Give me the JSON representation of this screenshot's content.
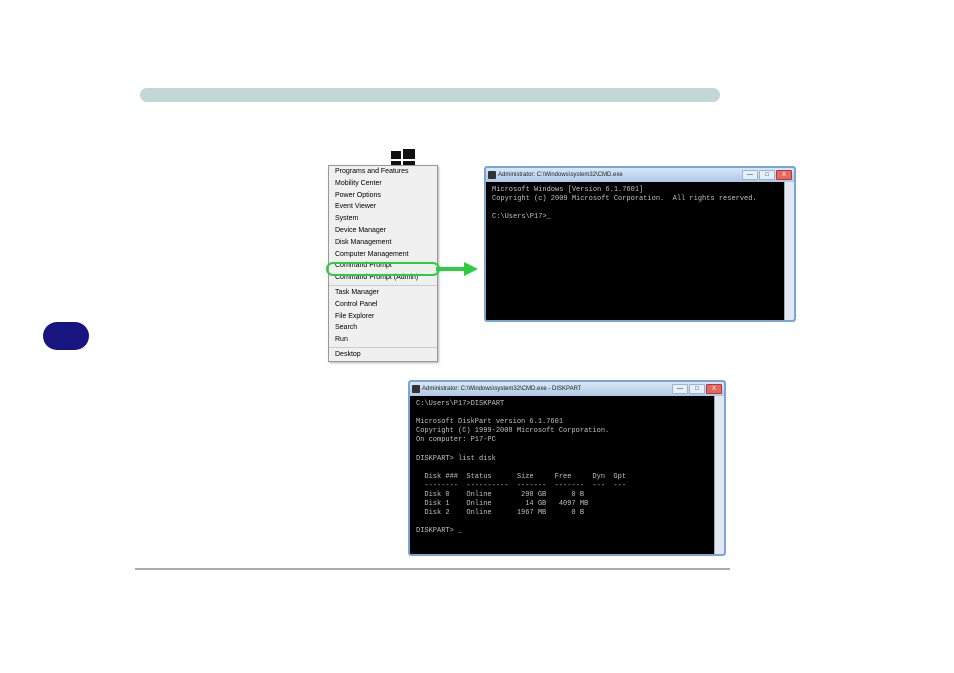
{
  "context_menu": {
    "items": [
      "Programs and Features",
      "Mobility Center",
      "Power Options",
      "Event Viewer",
      "System",
      "Device Manager",
      "Disk Management",
      "Computer Management",
      "Command Prompt",
      "Command Prompt (Admin)",
      "Task Manager",
      "Control Panel",
      "File Explorer",
      "Search",
      "Run",
      "Desktop"
    ],
    "highlighted_index": 9
  },
  "cmd1": {
    "title": "Administrator: C:\\Windows\\system32\\CMD.exe",
    "lines": [
      "Microsoft Windows [Version 6.1.7601]",
      "Copyright (c) 2009 Microsoft Corporation.  All rights reserved.",
      "",
      "C:\\Users\\P17>_"
    ]
  },
  "cmd2": {
    "title": "Administrator: C:\\Windows\\system32\\CMD.exe - DISKPART",
    "lines": [
      "C:\\Users\\P17>DISKPART",
      "",
      "Microsoft DiskPart version 6.1.7601",
      "Copyright (C) 1999-2008 Microsoft Corporation.",
      "On computer: P17-PC",
      "",
      "DISKPART> list disk",
      "",
      "  Disk ###  Status      Size     Free     Dyn  Gpt",
      "  --------  ----------  -------  -------  ---  ---",
      "  Disk 0    Online       298 GB      0 B",
      "  Disk 1    Online        14 GB   4097 MB",
      "  Disk 2    Online      1967 MB      0 B",
      "",
      "DISKPART> _"
    ]
  },
  "win_buttons": {
    "min": "—",
    "max": "□",
    "close": "X"
  }
}
